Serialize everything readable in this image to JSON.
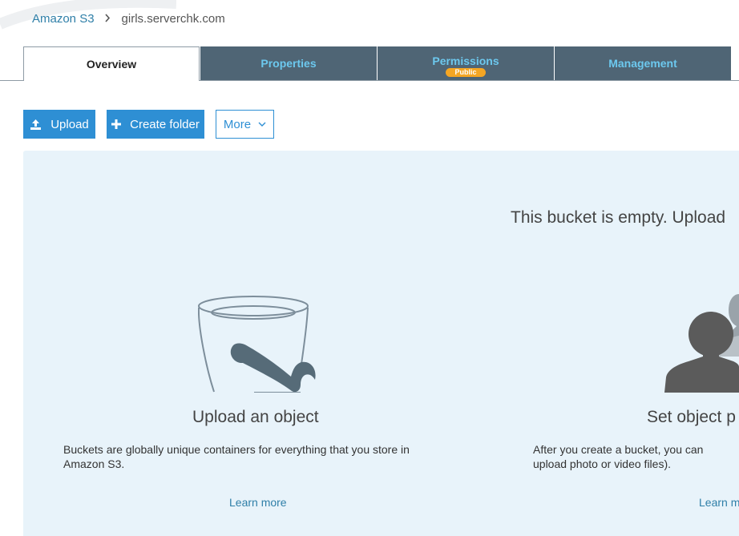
{
  "breadcrumb": {
    "root": "Amazon S3",
    "current": "girls.serverchk.com"
  },
  "tabs": [
    {
      "label": "Overview",
      "active": true
    },
    {
      "label": "Properties"
    },
    {
      "label": "Permissions",
      "badge": "Public"
    },
    {
      "label": "Management"
    }
  ],
  "toolbar": {
    "upload_label": "Upload",
    "create_folder_label": "Create folder",
    "more_label": "More"
  },
  "empty_state": {
    "title": "This bucket is empty. Upload",
    "cards": [
      {
        "title": "Upload an object",
        "description": "Buckets are globally unique containers for everything that you store in Amazon S3.",
        "link": "Learn more",
        "icon": "bucket-icon"
      },
      {
        "title": "Set object p",
        "description": "After you create a bucket, you can upload photo or video files).",
        "link": "Learn m",
        "icon": "users-icon"
      }
    ]
  },
  "colors": {
    "tab_dark": "#4f6575",
    "tab_text": "#6cc8ee",
    "primary": "#2e8fd4",
    "badge": "#f5a623",
    "panel": "#e8f3fa",
    "link": "#2f7fa8"
  }
}
